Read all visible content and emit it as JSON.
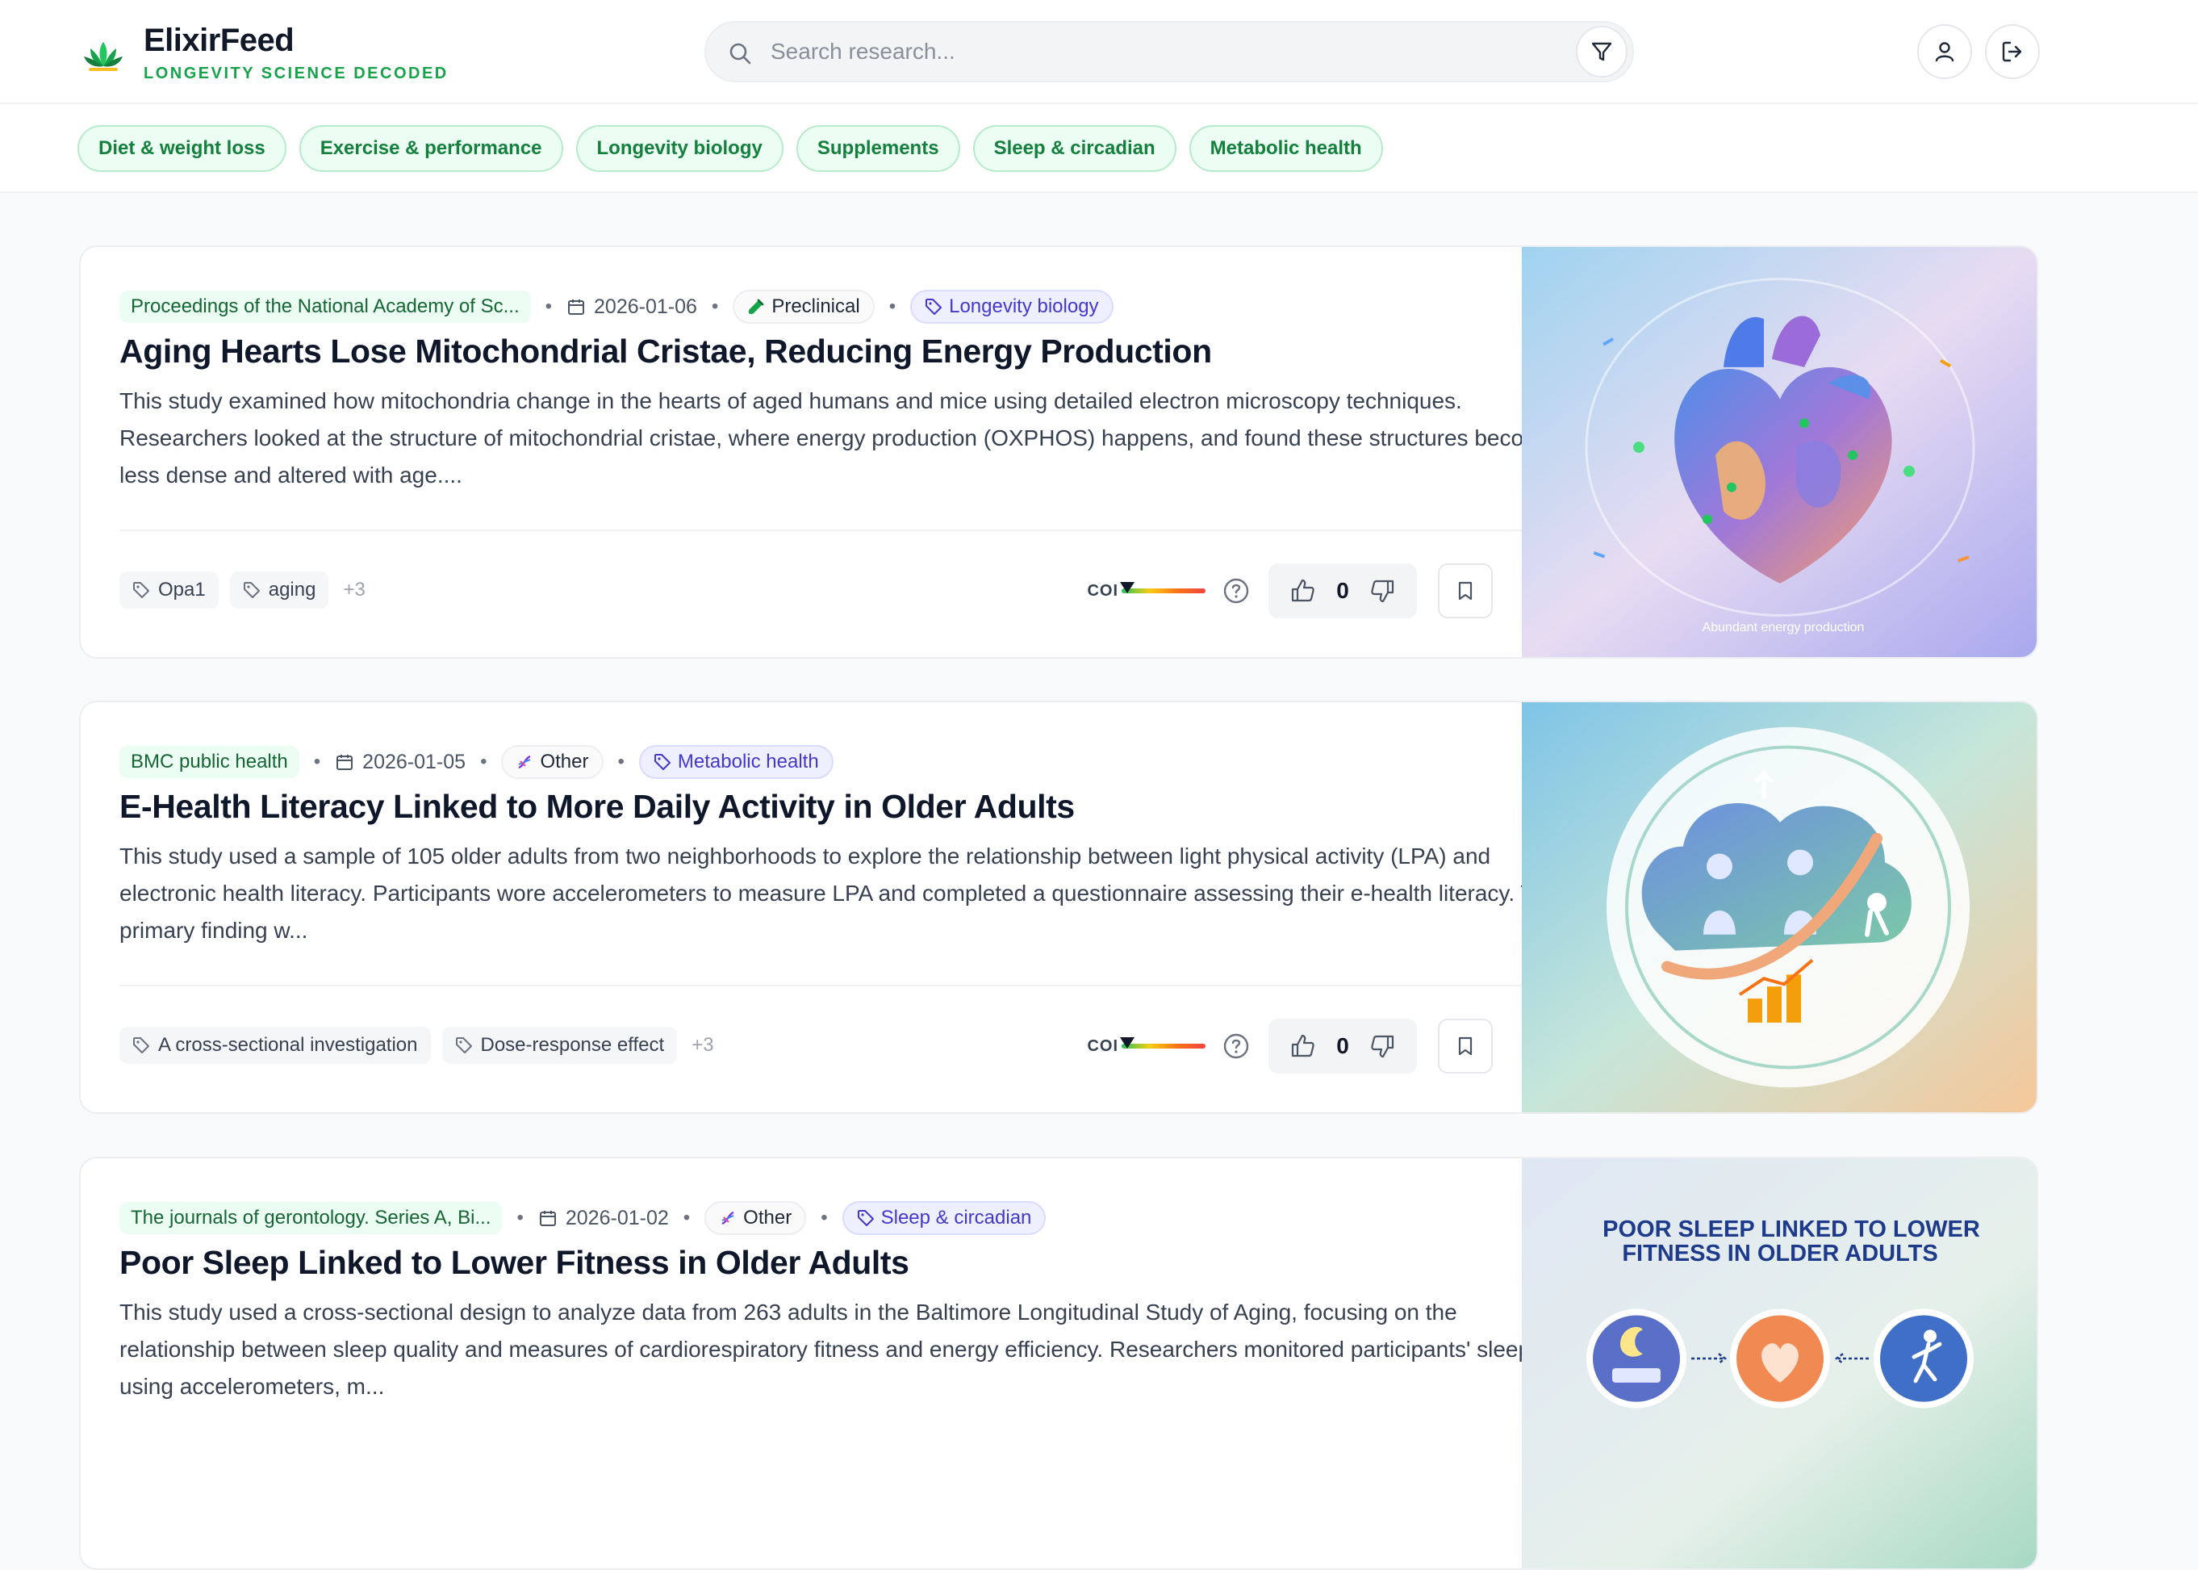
{
  "app": {
    "name": "ElixirFeed",
    "tagline": "LONGEVITY SCIENCE DECODED",
    "logo_icon": "lotus-icon"
  },
  "search": {
    "placeholder": "Search research...",
    "value": ""
  },
  "header_actions": {
    "filter_icon": "filter-icon",
    "profile_icon": "user-icon",
    "logout_icon": "logout-icon"
  },
  "topic_chips": [
    "Diet & weight loss",
    "Exercise & performance",
    "Longevity biology",
    "Supplements",
    "Sleep & circadian",
    "Metabolic health"
  ],
  "labels": {
    "coi": "COI"
  },
  "colors": {
    "brand_green": "#16a34a",
    "topic_indigo": "#4338ca",
    "chip_bg": "#ecfdf3"
  },
  "cards": [
    {
      "journal": "Proceedings of the National Academy of Sc...",
      "date": "2026-01-06",
      "study_type": "Preclinical",
      "study_type_icon": "test-tube-icon",
      "topic": "Longevity biology",
      "title": "Aging Hearts Lose Mitochondrial Cristae, Reducing Energy Production",
      "summary": "This study examined how mitochondria change in the hearts of aged humans and mice using detailed electron microscopy techniques. Researchers looked at the structure of mitochondrial cristae, where energy production (OXPHOS) happens, and found these structures become less dense and altered with age....",
      "tags": [
        "Opa1",
        "aging"
      ],
      "more_tags": "+3",
      "votes": "0",
      "coi_level": 0,
      "image_caption": "Abundant energy production"
    },
    {
      "journal": "BMC public health",
      "date": "2026-01-05",
      "study_type": "Other",
      "study_type_icon": "dna-icon",
      "topic": "Metabolic health",
      "title": "E-Health Literacy Linked to More Daily Activity in Older Adults",
      "summary": "This study used a sample of 105 older adults from two neighborhoods to explore the relationship between light physical activity (LPA) and electronic health literacy. Participants wore accelerometers to measure LPA and completed a questionnaire assessing their e-health literacy. The primary finding w...",
      "tags": [
        "A cross-sectional investigation",
        "Dose-response effect"
      ],
      "more_tags": "+3",
      "votes": "0",
      "coi_level": 0
    },
    {
      "journal": "The journals of gerontology. Series A, Bi...",
      "date": "2026-01-02",
      "study_type": "Other",
      "study_type_icon": "dna-icon",
      "topic": "Sleep & circadian",
      "title": "Poor Sleep Linked to Lower Fitness in Older Adults",
      "summary": "This study used a cross-sectional design to analyze data from 263 adults in the Baltimore Longitudinal Study of Aging, focusing on the relationship between sleep quality and measures of cardiorespiratory fitness and energy efficiency. Researchers monitored participants' sleep using accelerometers, m...",
      "image_heading_line1": "POOR SLEEP LINKED TO LOWER",
      "image_heading_line2": "FITNESS IN OLDER ADULTS"
    }
  ]
}
